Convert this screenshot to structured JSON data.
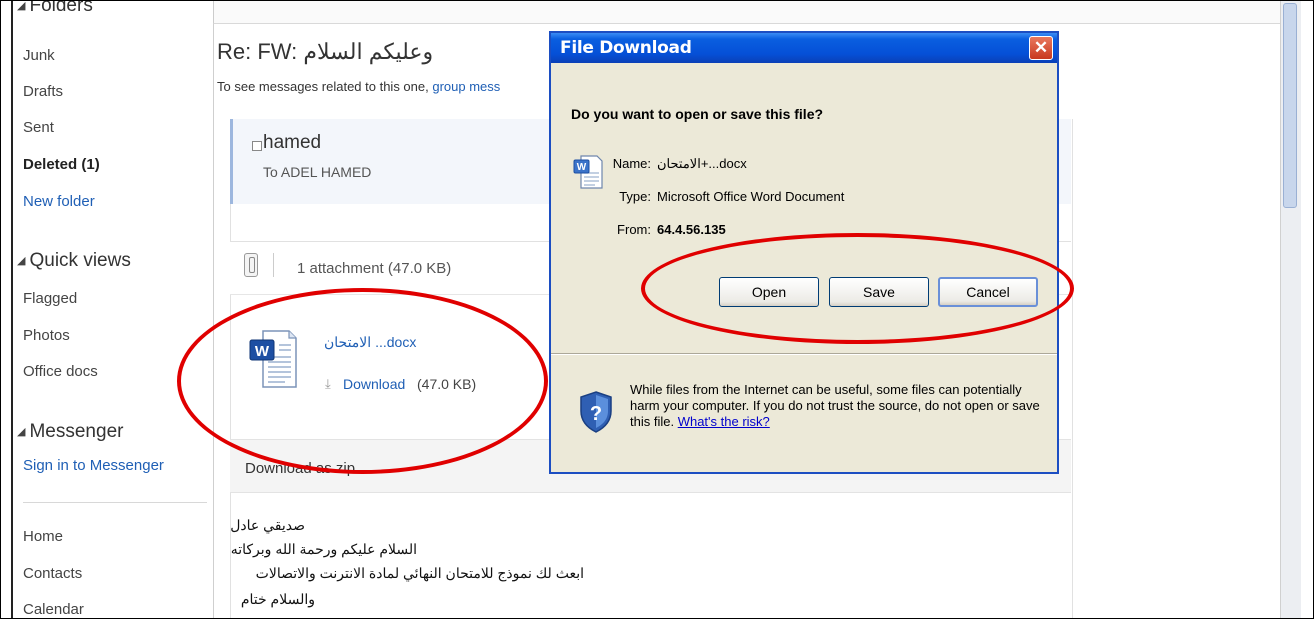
{
  "sidebar": {
    "folders_head": "Folders",
    "folders": [
      {
        "label": "Junk"
      },
      {
        "label": "Drafts"
      },
      {
        "label": "Sent"
      },
      {
        "label": "Deleted (1)"
      },
      {
        "label": "New folder"
      }
    ],
    "quick_head": "Quick views",
    "quick": [
      {
        "label": "Flagged"
      },
      {
        "label": "Photos"
      },
      {
        "label": "Office docs"
      }
    ],
    "messenger_head": "Messenger",
    "messenger_signin": "Sign in to Messenger",
    "bottom": [
      {
        "label": "Home"
      },
      {
        "label": "Contacts"
      },
      {
        "label": "Calendar"
      }
    ]
  },
  "message": {
    "subject": "Re: FW: وعليكم السلام",
    "related_prefix": "To see messages related to this one,",
    "related_link": "group mess",
    "sender": "hamed",
    "to": "To ADEL HAMED",
    "attachment_count": "1 attachment (47.0 KB)",
    "file_name": "الامتحان ...docx",
    "download_label": "Download",
    "download_size": "(47.0 KB)",
    "zip_label": "Download as zip",
    "body": [
      "صديقي عادل",
      "السلام عليكم ورحمة الله وبركاته",
      "ابعث لك نموذج للامتحان النهائي لمادة الانترنت والاتصالات",
      "والسلام ختام"
    ]
  },
  "dialog": {
    "title": "File Download",
    "close_glyph": "✕",
    "question": "Do you want to open or save this file?",
    "name_label": "Name:",
    "name_value": "الامتحان+...docx",
    "type_label": "Type:",
    "type_value": "Microsoft Office Word Document",
    "from_label": "From:",
    "from_value": "64.4.56.135",
    "open_label": "Open",
    "save_label": "Save",
    "cancel_label": "Cancel",
    "warning": "While files from the Internet can be useful, some files can potentially harm your computer. If you do not trust the source, do not open or save this file.",
    "risk_link": "What's the risk?"
  },
  "colors": {
    "link": "#1f5fb5",
    "title_bar": "#0550d7",
    "dialog_bg": "#ece9d8",
    "annotation": "#e00000"
  },
  "icons": [
    "triangle-down-icon",
    "collapse-box-icon",
    "paperclip-icon",
    "word-doc-icon",
    "download-arrow-icon",
    "close-icon",
    "security-shield-icon"
  ]
}
